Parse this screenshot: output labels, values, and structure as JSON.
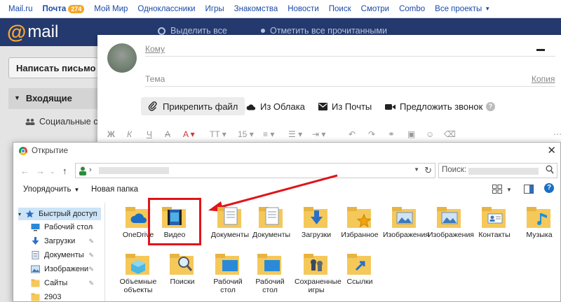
{
  "topbar": {
    "links": [
      "Mail.ru",
      "Почта",
      "Мой Мир",
      "Одноклассники",
      "Игры",
      "Знакомства",
      "Новости",
      "Поиск",
      "Смотри",
      "Combo",
      "Все проекты"
    ],
    "mail_badge": "274"
  },
  "mailheader": {
    "logo": "mail",
    "select_all": "Выделить все",
    "mark_all_read": "Отметить все прочитанными"
  },
  "sidebar": {
    "write": "Написать письмо",
    "inbox": "Входящие",
    "social": "Социальные с"
  },
  "compose": {
    "to": "Кому",
    "subject": "Тема",
    "copy": "Копия",
    "attach": "Прикрепить файл",
    "from_cloud": "Из Облака",
    "from_mail": "Из Почты",
    "call": "Предложить звонок",
    "format_size": "15"
  },
  "dialog": {
    "title": "Открытие",
    "search_label": "Поиск:",
    "organize": "Упорядочить",
    "new_folder": "Новая папка",
    "nav_items": [
      {
        "label": "Быстрый доступ",
        "icon": "star-icon"
      },
      {
        "label": "Рабочий стол",
        "icon": "desktop-icon"
      },
      {
        "label": "Загрузки",
        "icon": "download-icon"
      },
      {
        "label": "Документы",
        "icon": "documents-icon"
      },
      {
        "label": "Изображени",
        "icon": "pictures-icon"
      },
      {
        "label": "Сайты",
        "icon": "folder-icon"
      },
      {
        "label": "2903",
        "icon": "folder-icon"
      }
    ],
    "files_row1": [
      "OneDrive",
      "Видео",
      "Документы",
      "Документы",
      "Загрузки",
      "Избранное",
      "Изображения",
      "Изображения",
      "Контакты",
      "Музыка"
    ],
    "files_row2": [
      "Объемные объекты",
      "Поиски",
      "Рабочий стол",
      "Рабочий стол",
      "Сохраненные игры",
      "Ссылки"
    ]
  },
  "colors": {
    "header_bg": "#243a6e",
    "link": "#1a4aa8",
    "highlight": "#e0141a",
    "folder": "#f5c85a"
  }
}
